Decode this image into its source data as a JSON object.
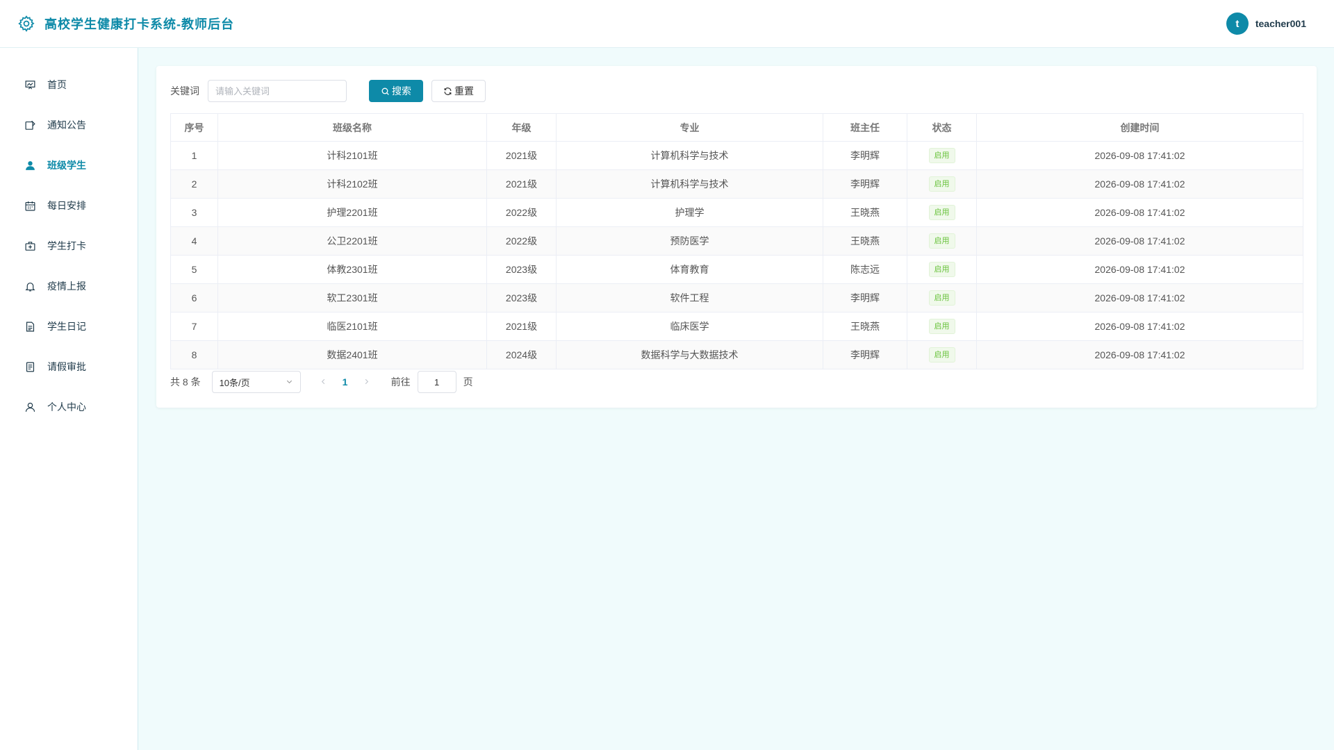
{
  "header": {
    "title": "高校学生健康打卡系统-教师后台",
    "logo_icon": "gear-icon",
    "avatar_letter": "t",
    "username": "teacher001"
  },
  "colors": {
    "accent": "#0e8aa8",
    "background": "#f0fbfc",
    "status_green": "#67c23a"
  },
  "sidebar": {
    "items": [
      {
        "label": "首页",
        "icon": "chart-board-icon",
        "active": false
      },
      {
        "label": "通知公告",
        "icon": "notice-icon",
        "active": false
      },
      {
        "label": "班级学生",
        "icon": "user-icon",
        "active": true
      },
      {
        "label": "每日安排",
        "icon": "calendar-icon",
        "active": false
      },
      {
        "label": "学生打卡",
        "icon": "medical-kit-icon",
        "active": false
      },
      {
        "label": "疫情上报",
        "icon": "bell-icon",
        "active": false
      },
      {
        "label": "学生日记",
        "icon": "document-icon",
        "active": false
      },
      {
        "label": "请假审批",
        "icon": "form-icon",
        "active": false
      },
      {
        "label": "个人中心",
        "icon": "person-outline-icon",
        "active": false
      }
    ]
  },
  "search": {
    "label": "关键词",
    "placeholder": "请输入关键词",
    "value": "",
    "search_button": "搜索",
    "reset_button": "重置"
  },
  "table": {
    "columns": [
      "序号",
      "班级名称",
      "年级",
      "专业",
      "班主任",
      "状态",
      "创建时间"
    ],
    "rows": [
      [
        "1",
        "计科2101班",
        "2021级",
        "计算机科学与技术",
        "李明辉",
        "启用",
        "2026-09-08 17:41:02"
      ],
      [
        "2",
        "计科2102班",
        "2021级",
        "计算机科学与技术",
        "李明辉",
        "启用",
        "2026-09-08 17:41:02"
      ],
      [
        "3",
        "护理2201班",
        "2022级",
        "护理学",
        "王晓燕",
        "启用",
        "2026-09-08 17:41:02"
      ],
      [
        "4",
        "公卫2201班",
        "2022级",
        "预防医学",
        "王晓燕",
        "启用",
        "2026-09-08 17:41:02"
      ],
      [
        "5",
        "体教2301班",
        "2023级",
        "体育教育",
        "陈志远",
        "启用",
        "2026-09-08 17:41:02"
      ],
      [
        "6",
        "软工2301班",
        "2023级",
        "软件工程",
        "李明辉",
        "启用",
        "2026-09-08 17:41:02"
      ],
      [
        "7",
        "临医2101班",
        "2021级",
        "临床医学",
        "王晓燕",
        "启用",
        "2026-09-08 17:41:02"
      ],
      [
        "8",
        "数据2401班",
        "2024级",
        "数据科学与大数据技术",
        "李明辉",
        "启用",
        "2026-09-08 17:41:02"
      ]
    ]
  },
  "pagination": {
    "total_text": "共 8 条",
    "page_size": "10条/页",
    "current_page": "1",
    "goto_label": "前往",
    "goto_value": "1",
    "goto_suffix": "页"
  }
}
